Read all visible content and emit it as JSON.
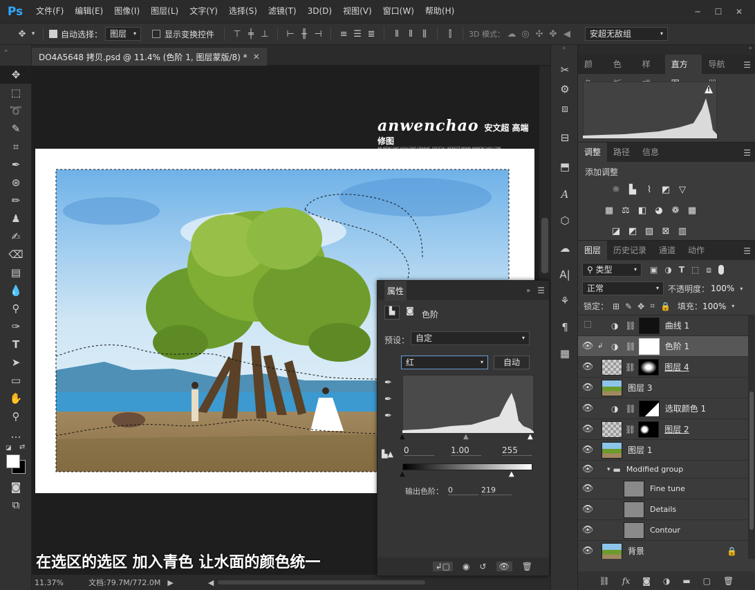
{
  "app": {
    "logo": "Ps"
  },
  "menu": [
    "文件(F)",
    "编辑(E)",
    "图像(I)",
    "图层(L)",
    "文字(Y)",
    "选择(S)",
    "滤镜(T)",
    "3D(D)",
    "视图(V)",
    "窗口(W)",
    "帮助(H)"
  ],
  "window_controls": [
    "─",
    "☐",
    "✕"
  ],
  "options": {
    "auto_select_label": "自动选择：",
    "auto_select_value": "图层",
    "show_transform_label": "显示变换控件",
    "mode_3d_label": "3D 模式：",
    "workspace": "安超无敌组"
  },
  "document": {
    "tab_title": "DO4A5648 拷贝.psd @ 11.4% (色阶 1, 图层蒙版/8) *",
    "watermark_main": "anwenchao",
    "watermark_cn": "安文超 高端修图",
    "watermark_sub": "AN WENCHAO HIGH-END GRAPHIC OFFICIAL WEBSITE/WWW.ANWENCHAO.COM",
    "caption": "在选区的选区  加入青色  让水面的颜色统一"
  },
  "status": {
    "zoom": "11.37%",
    "doc": "文档:79.7M/772.0M"
  },
  "histogram_panel": {
    "tabs": [
      "颜色",
      "色板",
      "样式",
      "直方图",
      "导航器"
    ],
    "active": 3,
    "warning": "!"
  },
  "adjust_panel": {
    "tabs": [
      "调整",
      "路径",
      "信息"
    ],
    "active": 0,
    "title": "添加调整"
  },
  "layers_panel": {
    "tabs": [
      "图层",
      "历史记录",
      "通道",
      "动作"
    ],
    "active": 0,
    "filter": "类型",
    "blend_mode": "正常",
    "opacity_label": "不透明度：",
    "opacity": "100%",
    "lock_label": "锁定：",
    "fill_label": "填充：",
    "fill": "100%",
    "layers": [
      {
        "name": "曲线 1"
      },
      {
        "name": "色阶 1"
      },
      {
        "name": "图层 4"
      },
      {
        "name": "图层 3"
      },
      {
        "name": "选取颜色 1"
      },
      {
        "name": "图层 2"
      },
      {
        "name": "图层 1"
      },
      {
        "name": "Modified group"
      },
      {
        "name": "Fine tune"
      },
      {
        "name": "Details"
      },
      {
        "name": "Contour"
      },
      {
        "name": "背景"
      }
    ]
  },
  "properties": {
    "title": "属性",
    "type": "色阶",
    "preset_label": "预设：",
    "preset": "自定",
    "channel": "红",
    "auto": "自动",
    "input_black": "0",
    "input_gamma": "1.00",
    "input_white": "255",
    "output_label": "输出色阶：",
    "output_black": "0",
    "output_white": "219"
  },
  "colors": {
    "accent": "#31a8ff",
    "panel": "#3b3b3b",
    "bg": "#1e1e1e"
  }
}
